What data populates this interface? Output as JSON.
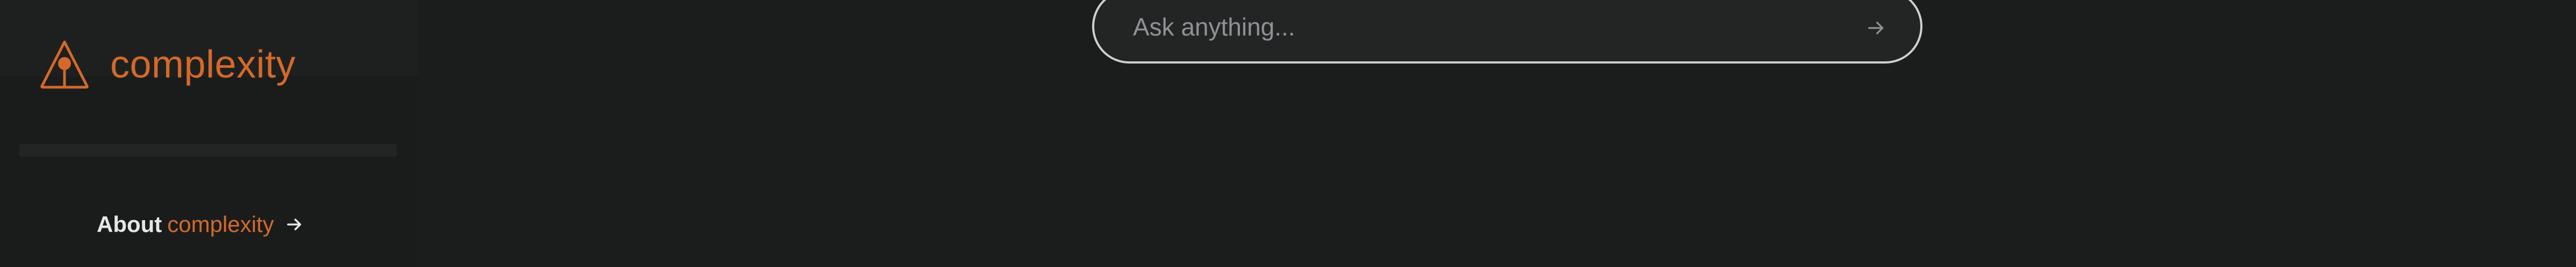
{
  "sidebar": {
    "brand": {
      "name": "complexity",
      "logo_icon": "triangle-light-icon"
    },
    "about": {
      "prefix": "About",
      "brand": "complexity",
      "arrow_icon": "arrow-right-icon"
    }
  },
  "search": {
    "placeholder": "Ask anything...",
    "value": "",
    "submit_icon": "arrow-right-icon"
  },
  "colors": {
    "background": "#1b1d1d",
    "accent": "#d4692a",
    "border": "#cfcfcf"
  }
}
